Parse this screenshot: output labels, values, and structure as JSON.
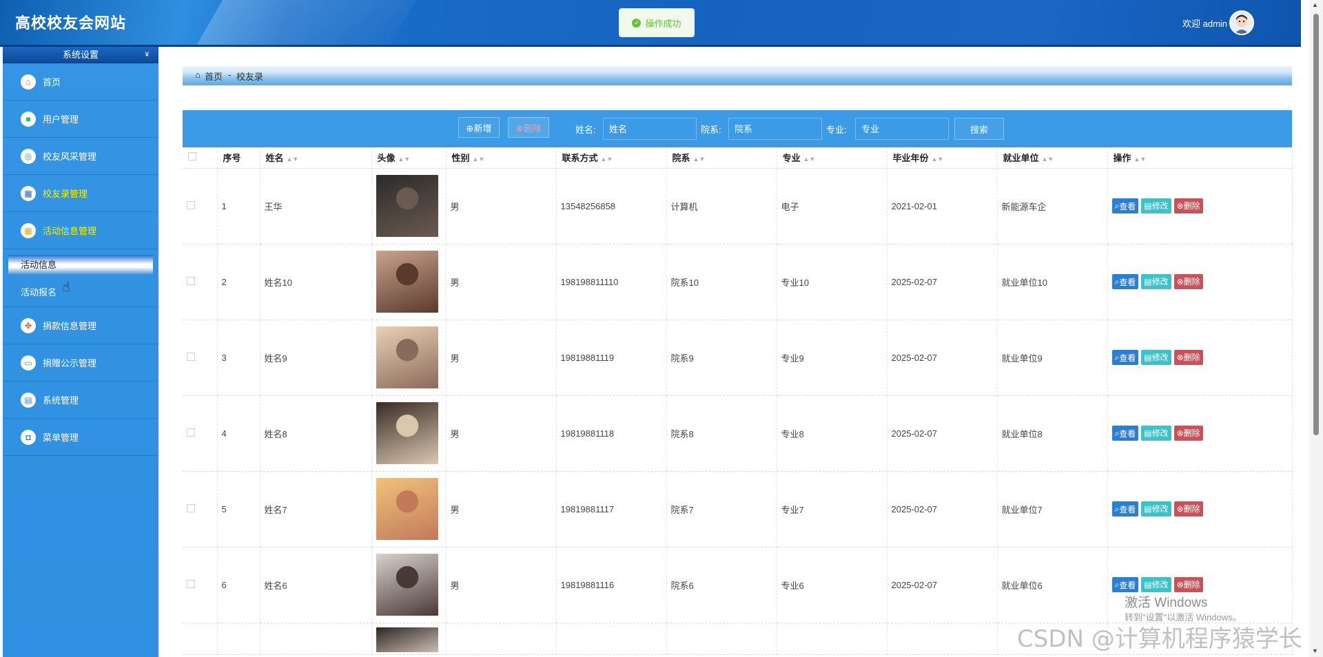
{
  "header": {
    "title": "高校校友会网站",
    "toast": "操作成功",
    "welcome": "欢迎 admin"
  },
  "sidebar": {
    "section_title": "系统设置",
    "items": [
      {
        "label": "首页",
        "icon": "home-icon"
      },
      {
        "label": "用户管理",
        "icon": "user-icon"
      },
      {
        "label": "校友风采管理",
        "icon": "globe-icon"
      },
      {
        "label": "校友录管理",
        "icon": "grid-icon"
      },
      {
        "label": "活动信息管理",
        "icon": "apps-icon"
      }
    ],
    "sub_items": [
      {
        "label": "活动信息"
      },
      {
        "label": "活动报名"
      }
    ],
    "items_after": [
      {
        "label": "捐款信息管理",
        "icon": "clover-icon"
      },
      {
        "label": "捐赠公示管理",
        "icon": "card-icon"
      },
      {
        "label": "系统管理",
        "icon": "window-icon"
      },
      {
        "label": "菜单管理",
        "icon": "crop-icon"
      }
    ]
  },
  "breadcrumb": {
    "home": "首页",
    "separator": "-",
    "current": "校友录"
  },
  "toolbar": {
    "add_label": "⊕新增",
    "delete_label": "⊗删除",
    "name_label": "姓名:",
    "name_placeholder": "姓名",
    "dept_label": "院系:",
    "dept_placeholder": "院系",
    "major_label": "专业:",
    "major_placeholder": "专业",
    "search_label": "搜索"
  },
  "table": {
    "columns": [
      "序号",
      "姓名",
      "头像",
      "性别",
      "联系方式",
      "院系",
      "专业",
      "毕业年份",
      "就业单位",
      "操作"
    ],
    "actions": {
      "view": "查看",
      "edit": "修改",
      "delete": "删除"
    },
    "rows": [
      {
        "no": "1",
        "name": "王华",
        "gender": "男",
        "phone": "13548256858",
        "dept": "计算机",
        "major": "电子",
        "year": "2021-02-01",
        "employer": "新能源车企"
      },
      {
        "no": "2",
        "name": "姓名10",
        "gender": "男",
        "phone": "198198811110",
        "dept": "院系10",
        "major": "专业10",
        "year": "2025-02-07",
        "employer": "就业单位10"
      },
      {
        "no": "3",
        "name": "姓名9",
        "gender": "男",
        "phone": "19819881119",
        "dept": "院系9",
        "major": "专业9",
        "year": "2025-02-07",
        "employer": "就业单位9"
      },
      {
        "no": "4",
        "name": "姓名8",
        "gender": "男",
        "phone": "19819881118",
        "dept": "院系8",
        "major": "专业8",
        "year": "2025-02-07",
        "employer": "就业单位8"
      },
      {
        "no": "5",
        "name": "姓名7",
        "gender": "男",
        "phone": "19819881117",
        "dept": "院系7",
        "major": "专业7",
        "year": "2025-02-07",
        "employer": "就业单位7"
      },
      {
        "no": "6",
        "name": "姓名6",
        "gender": "男",
        "phone": "19819881116",
        "dept": "院系6",
        "major": "专业6",
        "year": "2025-02-07",
        "employer": "就业单位6"
      }
    ]
  },
  "watermarks": {
    "windows": "激活 Windows",
    "windows_sub": "转到\"设置\"以激活 Windows。",
    "csdn": "CSDN @计算机程序猿学长"
  }
}
